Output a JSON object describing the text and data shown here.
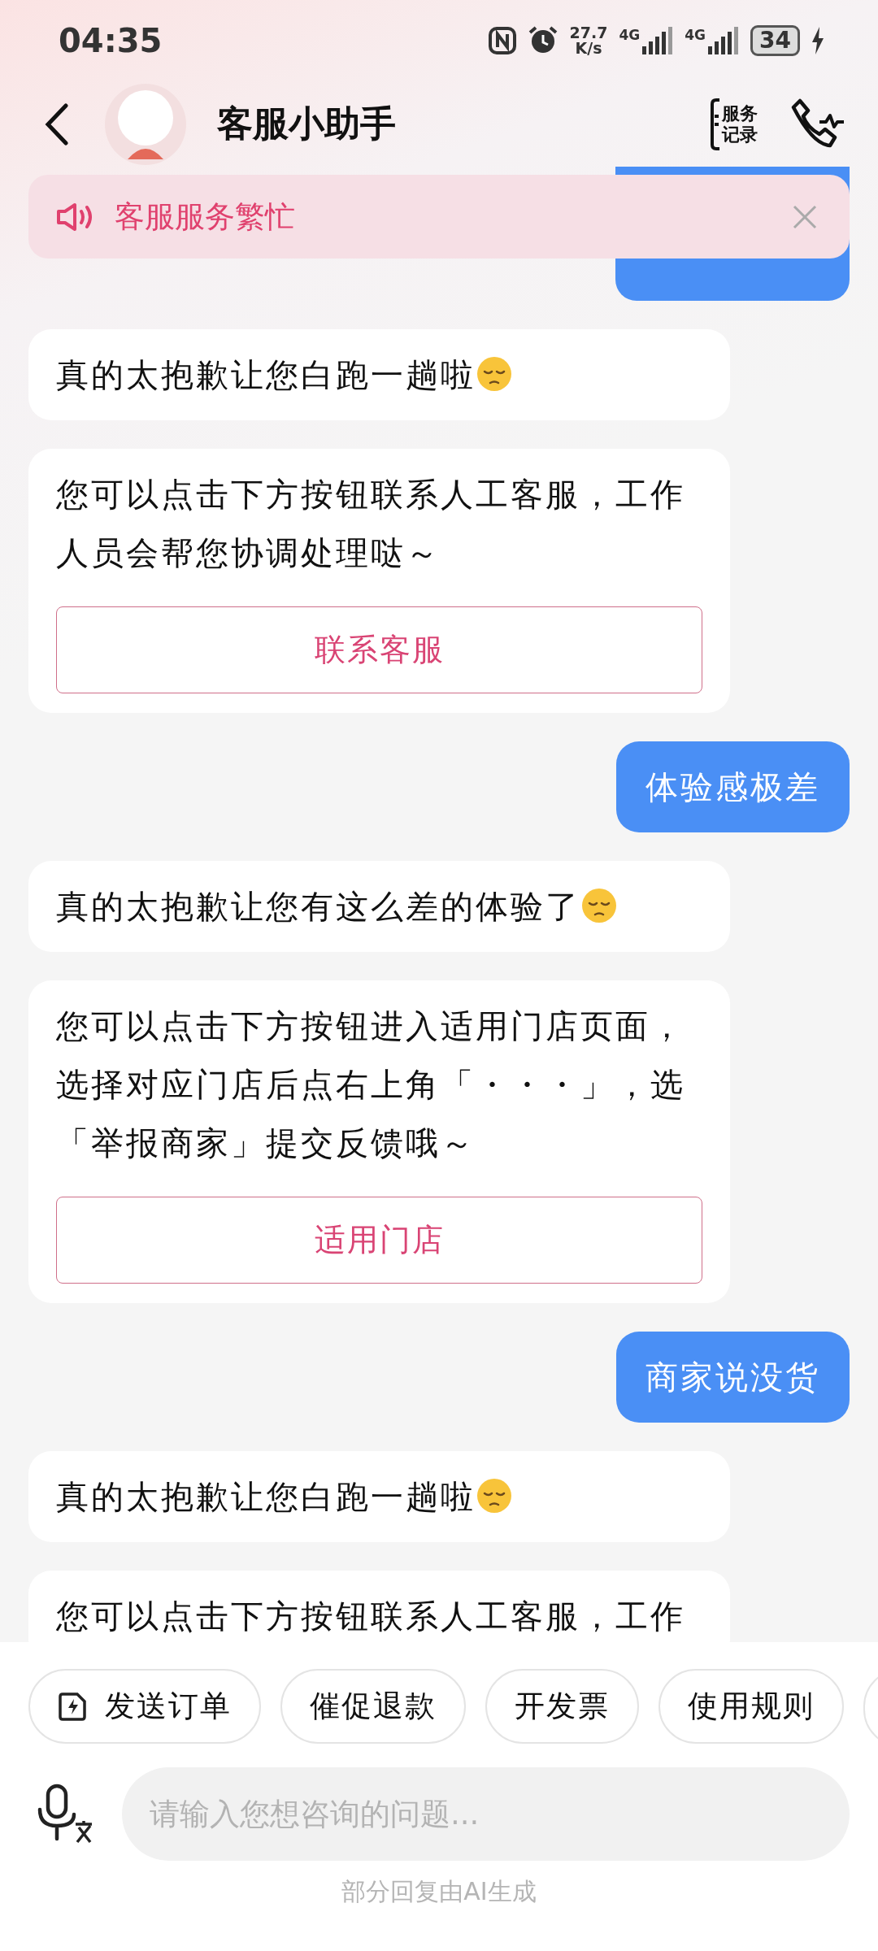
{
  "status_bar": {
    "time": "04:35",
    "net_speed_value": "27.7",
    "net_speed_unit": "K/s",
    "network_labels": [
      "4G",
      "4G"
    ],
    "battery": "34",
    "charging": true
  },
  "header": {
    "title": "客服小助手",
    "records_label": [
      "服务",
      "记录"
    ]
  },
  "notice": {
    "text": "客服服务繁忙"
  },
  "messages": [
    {
      "kind": "user_partial"
    },
    {
      "kind": "bot_text",
      "text": "真的太抱歉让您白跑一趟啦",
      "emoji": true
    },
    {
      "kind": "bot_card",
      "text": "您可以点击下方按钮联系人工客服，工作人员会帮您协调处理哒～",
      "button": "联系客服"
    },
    {
      "kind": "user_text",
      "text": "体验感极差",
      "emoji": false
    },
    {
      "kind": "bot_text",
      "text": "真的太抱歉让您有这么差的体验了",
      "emoji": true
    },
    {
      "kind": "bot_card",
      "text": "您可以点击下方按钮进入适用门店页面，选择对应门店后点右上角「・・・」，选「举报商家」提交反馈哦～",
      "button": "适用门店"
    },
    {
      "kind": "user_text",
      "text": "商家说没货",
      "emoji": false
    },
    {
      "kind": "bot_text",
      "text": "真的太抱歉让您白跑一趟啦",
      "emoji": true
    },
    {
      "kind": "bot_text",
      "text": "您可以点击下方按钮联系人工客服，工作",
      "emoji": false
    }
  ],
  "quick_actions": [
    {
      "kind": "order",
      "label": "发送订单"
    },
    {
      "kind": "plain",
      "label": "催促退款"
    },
    {
      "kind": "plain",
      "label": "开发票"
    },
    {
      "kind": "plain",
      "label": "使用规则"
    },
    {
      "kind": "cut"
    }
  ],
  "input": {
    "placeholder": "请输入您想咨询的问题..."
  },
  "footer_note": "部分回复由AI生成"
}
